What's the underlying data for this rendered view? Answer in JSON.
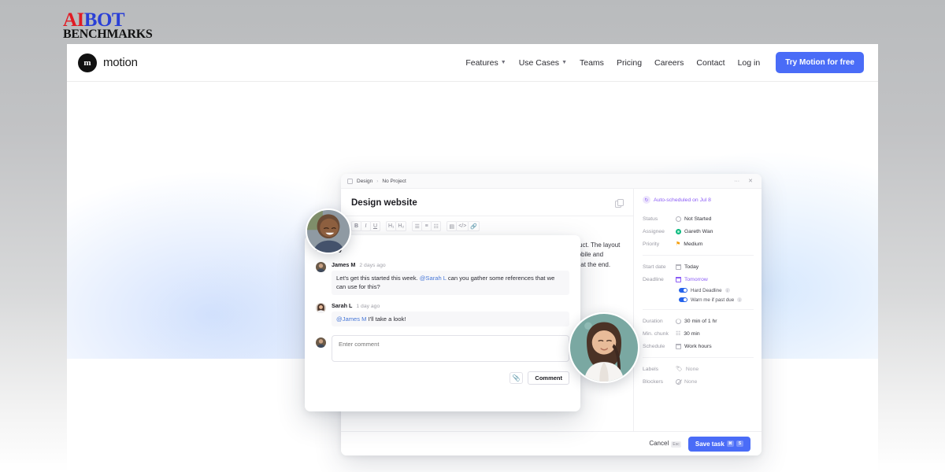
{
  "watermark": {
    "line1_a": "AI",
    "line1_b": "BOT",
    "line2": "BENCHMARKS"
  },
  "nav": {
    "brand": "motion",
    "brand_mark": "m",
    "links": [
      {
        "label": "Features",
        "caret": "▼"
      },
      {
        "label": "Use Cases",
        "caret": "▼"
      },
      {
        "label": "Teams",
        "caret": ""
      },
      {
        "label": "Pricing",
        "caret": ""
      },
      {
        "label": "Careers",
        "caret": ""
      },
      {
        "label": "Contact",
        "caret": ""
      },
      {
        "label": "Log in",
        "caret": ""
      }
    ],
    "cta": "Try Motion for free"
  },
  "modal": {
    "breadcrumb": {
      "project": "Design",
      "separator": "›",
      "sub": "No Project"
    },
    "more_menu": "···",
    "close": "✕",
    "title": "Design website",
    "toolbar": [
      {
        "name": "bold",
        "glyph": "B",
        "cls": "bold",
        "group": 0
      },
      {
        "name": "italic",
        "glyph": "I",
        "cls": "ital",
        "group": 0
      },
      {
        "name": "underline",
        "glyph": "U",
        "cls": "und",
        "group": 0
      },
      {
        "name": "heading-1",
        "glyph": "H₁",
        "cls": "",
        "group": 1
      },
      {
        "name": "heading-2",
        "glyph": "H₂",
        "cls": "",
        "group": 1
      },
      {
        "name": "bullet-list",
        "glyph": "☰",
        "cls": "",
        "group": 2
      },
      {
        "name": "ordered-list",
        "glyph": "≡",
        "cls": "",
        "group": 2
      },
      {
        "name": "task-list",
        "glyph": "☷",
        "cls": "",
        "group": 2
      },
      {
        "name": "table",
        "glyph": "▤",
        "cls": "",
        "group": 3
      },
      {
        "name": "code-block",
        "glyph": "</>",
        "cls": "",
        "group": 3
      },
      {
        "name": "link",
        "glyph": "🔗",
        "cls": "",
        "group": 3
      }
    ],
    "description": "Redesign the marketing landing page to better communicate the value of the product. The layout should be clean, modern and visually appealing. The page should work well on mobile and desktop alike. Include a hero section, feature grid and a footer with a call to action at the end.",
    "footer": {
      "cancel_label": "Cancel",
      "cancel_key": "Esc",
      "save_label": "Save task",
      "save_key_1": "⌘",
      "save_key_2": "S"
    }
  },
  "props": {
    "auto_scheduled": "Auto-scheduled on Jul 8",
    "auto_scheduled_icon": "↻",
    "groups": [
      {
        "rows": [
          {
            "label": "Status",
            "value": "Not Started",
            "icon": "status-circle-icon",
            "tone": ""
          },
          {
            "label": "Assignee",
            "value": "Gareth Wan",
            "icon": "assignee-avatar-icon",
            "tone": ""
          },
          {
            "label": "Priority",
            "value": "Medium",
            "icon": "priority-flag-icon",
            "tone": ""
          }
        ]
      },
      {
        "rows": [
          {
            "label": "Start date",
            "value": "Today",
            "icon": "calendar-icon",
            "tone": ""
          },
          {
            "label": "Deadline",
            "value": "Tomorrow",
            "icon": "calendar-purple-icon",
            "tone": "purple"
          }
        ],
        "toggles": [
          {
            "label": "Hard Deadline",
            "on": true
          },
          {
            "label": "Warn me if past due",
            "on": true
          }
        ]
      },
      {
        "rows": [
          {
            "label": "Duration",
            "value": "30 min  of  1 hr",
            "icon": "duration-pie-icon",
            "tone": ""
          },
          {
            "label": "Min. chunk",
            "value": "30 min",
            "icon": "chunk-grid-icon",
            "tone": ""
          },
          {
            "label": "Schedule",
            "value": "Work hours",
            "icon": "schedule-calendar-icon",
            "tone": ""
          }
        ]
      },
      {
        "rows": [
          {
            "label": "Labels",
            "value": "None",
            "icon": "tag-icon",
            "tone": "muted"
          },
          {
            "label": "Blockers",
            "value": "None",
            "icon": "blocker-icon",
            "tone": "muted"
          }
        ]
      }
    ]
  },
  "activity": {
    "heading": "Activity",
    "comments": [
      {
        "author": "James M",
        "time": "2 days ago",
        "text_before": "Let's get this started this week. ",
        "mention": "@Sarah L",
        "text_after": " can you gather some references that we can use for this?"
      },
      {
        "author": "Sarah L",
        "time": "1 day ago",
        "text_before": "",
        "mention": "@James M",
        "text_after": " I'll take a look!"
      }
    ],
    "composer": {
      "placeholder": "Enter comment",
      "value": "",
      "attach_icon": "📎",
      "submit_label": "Comment"
    }
  },
  "colors": {
    "accent_blue": "#4a6cf7",
    "purple": "#8b5cf6",
    "mention_blue": "#4a79d8",
    "green": "#10b981",
    "amber": "#f59e0b"
  }
}
